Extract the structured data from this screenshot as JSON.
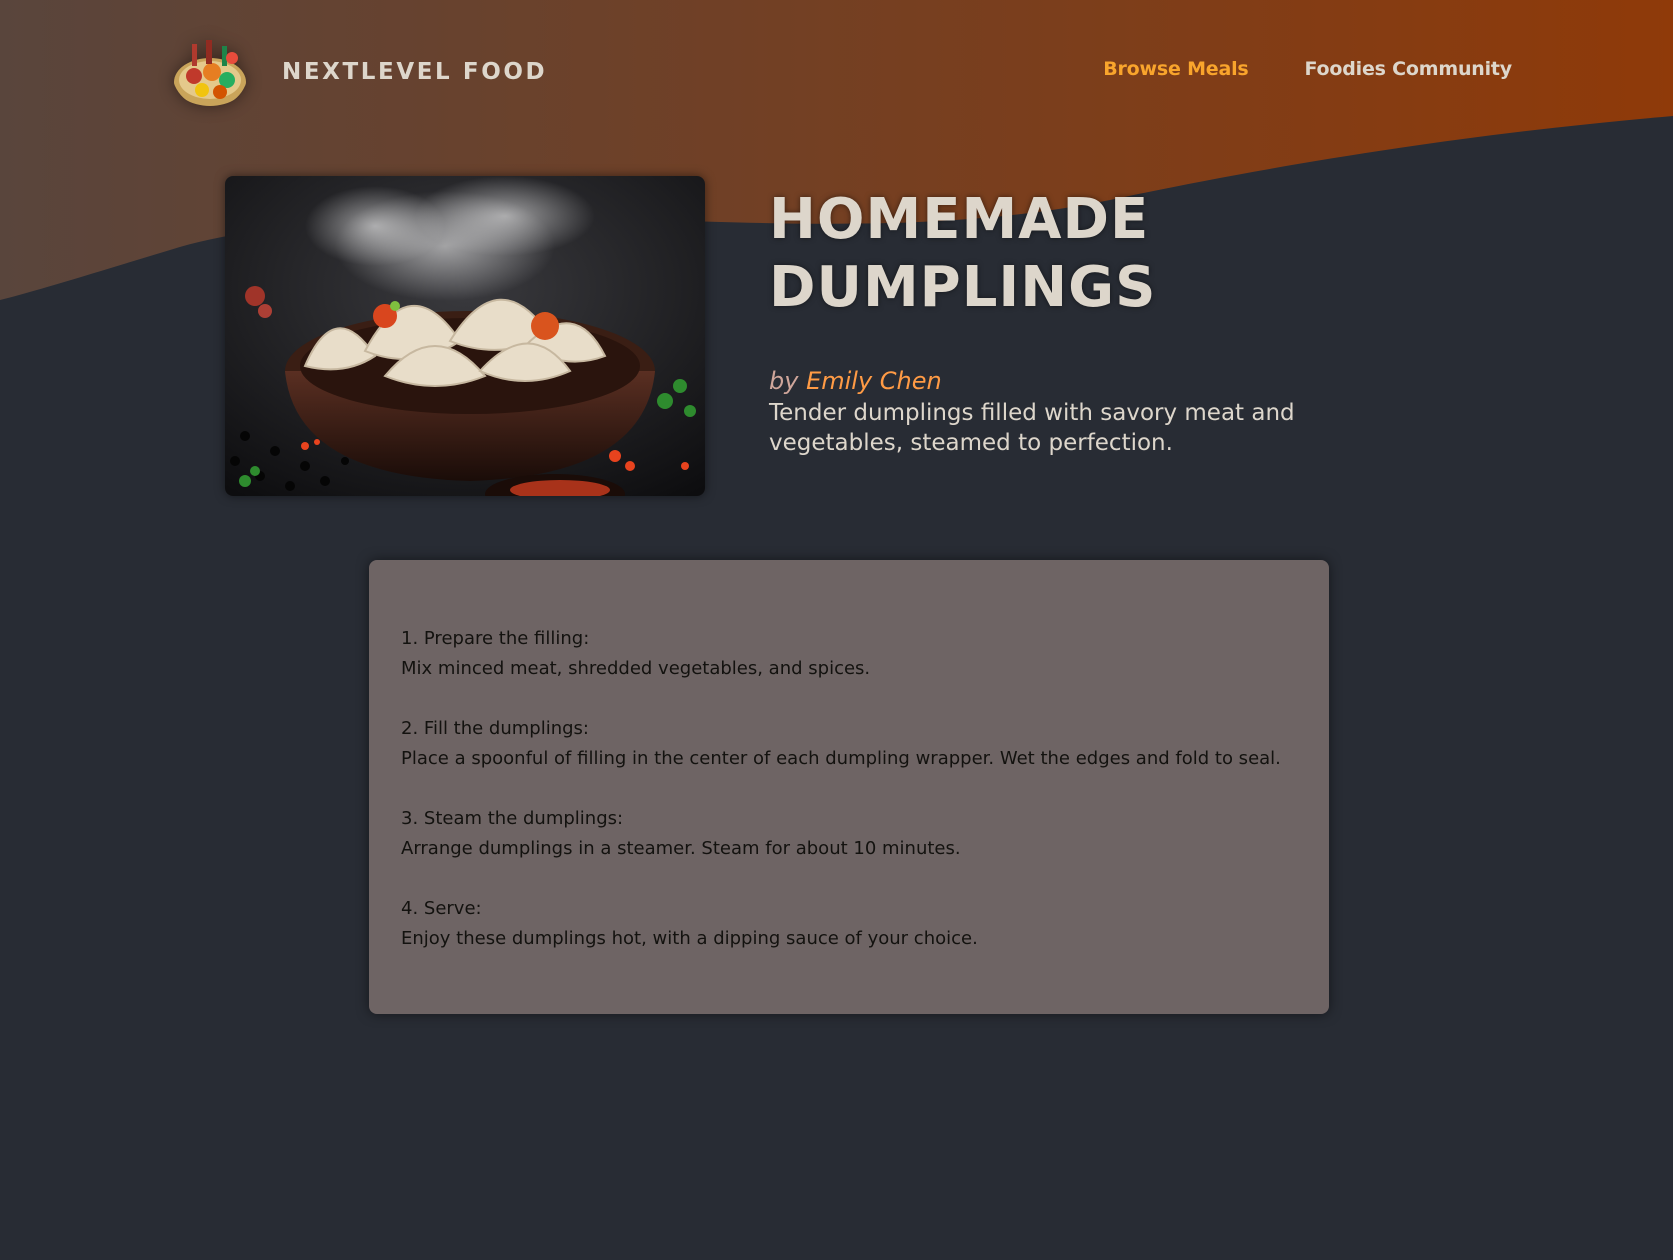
{
  "brand": {
    "name": "NEXTLEVEL FOOD",
    "logo_icon": "food-plate-icon"
  },
  "nav": [
    {
      "label": "Browse Meals",
      "active": true
    },
    {
      "label": "Foodies Community",
      "active": false
    }
  ],
  "meal": {
    "image_icon": "dumplings-photo",
    "title": "HOMEMADE DUMPLINGS",
    "by_prefix": "by",
    "creator": "Emily Chen",
    "summary": "Tender dumplings filled with savory meat and vegetables, steamed to perfection."
  },
  "instructions": [
    {
      "title": "1. Prepare the filling:",
      "text": "Mix minced meat, shredded vegetables, and spices."
    },
    {
      "title": "2. Fill the dumplings:",
      "text": "Place a spoonful of filling in the center of each dumpling wrapper. Wet the edges and fold to seal."
    },
    {
      "title": "3. Steam the dumplings:",
      "text": "Arrange dumplings in a steamer. Steam for about 10 minutes."
    },
    {
      "title": "4. Serve:",
      "text": "Enjoy these dumplings hot, with a dipping sauce of your choice."
    }
  ],
  "colors": {
    "background": "#282c34",
    "header_gradient_start": "#59453c",
    "header_gradient_end": "#8f3a09",
    "accent": "#f9a52c",
    "creator_link": "#ff9b45",
    "card": "#6e6464",
    "text_light": "#ddd6cb"
  }
}
